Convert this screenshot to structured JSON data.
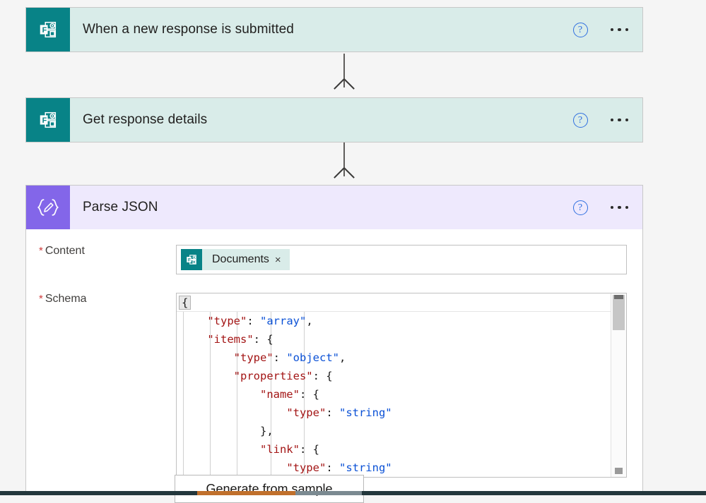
{
  "flow": {
    "steps": [
      {
        "id": "trigger",
        "title": "When a new response is submitted",
        "icon": "microsoft-forms-icon",
        "theme": "teal",
        "help_label": "?",
        "menu_label": "…"
      },
      {
        "id": "get-response-details",
        "title": "Get response details",
        "icon": "microsoft-forms-icon",
        "theme": "teal",
        "help_label": "?",
        "menu_label": "…"
      },
      {
        "id": "parse-json",
        "title": "Parse JSON",
        "icon": "parse-json-icon",
        "theme": "lilac",
        "help_label": "?",
        "menu_label": "…"
      }
    ]
  },
  "parse_json": {
    "content_field": {
      "label": "Content",
      "required_marker": "*",
      "token": {
        "text": "Documents",
        "icon": "microsoft-forms-icon",
        "remove_label": "×"
      }
    },
    "schema_field": {
      "label": "Schema",
      "required_marker": "*",
      "lines": [
        {
          "indent": 0,
          "active": true,
          "parts": [
            {
              "t": "pun",
              "v": "{"
            }
          ]
        },
        {
          "indent": 1,
          "active": false,
          "parts": [
            {
              "t": "key",
              "v": "\"type\""
            },
            {
              "t": "pun",
              "v": ": "
            },
            {
              "t": "str",
              "v": "\"array\""
            },
            {
              "t": "pun",
              "v": ","
            }
          ]
        },
        {
          "indent": 1,
          "active": false,
          "parts": [
            {
              "t": "key",
              "v": "\"items\""
            },
            {
              "t": "pun",
              "v": ": {"
            }
          ]
        },
        {
          "indent": 2,
          "active": false,
          "parts": [
            {
              "t": "key",
              "v": "\"type\""
            },
            {
              "t": "pun",
              "v": ": "
            },
            {
              "t": "str",
              "v": "\"object\""
            },
            {
              "t": "pun",
              "v": ","
            }
          ]
        },
        {
          "indent": 2,
          "active": false,
          "parts": [
            {
              "t": "key",
              "v": "\"properties\""
            },
            {
              "t": "pun",
              "v": ": {"
            }
          ]
        },
        {
          "indent": 3,
          "active": false,
          "parts": [
            {
              "t": "key",
              "v": "\"name\""
            },
            {
              "t": "pun",
              "v": ": {"
            }
          ]
        },
        {
          "indent": 4,
          "active": false,
          "parts": [
            {
              "t": "key",
              "v": "\"type\""
            },
            {
              "t": "pun",
              "v": ": "
            },
            {
              "t": "str",
              "v": "\"string\""
            }
          ]
        },
        {
          "indent": 3,
          "active": false,
          "parts": [
            {
              "t": "pun",
              "v": "},"
            }
          ]
        },
        {
          "indent": 3,
          "active": false,
          "parts": [
            {
              "t": "key",
              "v": "\"link\""
            },
            {
              "t": "pun",
              "v": ": {"
            }
          ]
        },
        {
          "indent": 4,
          "active": false,
          "parts": [
            {
              "t": "key",
              "v": "\"type\""
            },
            {
              "t": "pun",
              "v": ": "
            },
            {
              "t": "str",
              "v": "\"string\""
            }
          ]
        }
      ]
    },
    "generate_button": {
      "label": "Generate from sample"
    }
  },
  "colors": {
    "forms_teal": "#088387",
    "card_teal_bg": "#d9ece9",
    "json_purple": "#8366e9",
    "card_lilac_bg": "#eee9fd",
    "help_blue": "#2f6fe0",
    "required_red": "#cf3b3b",
    "json_key_red": "#a31515",
    "json_string_blue": "#0b51d6",
    "canvas_gray": "#f5f5f5"
  }
}
